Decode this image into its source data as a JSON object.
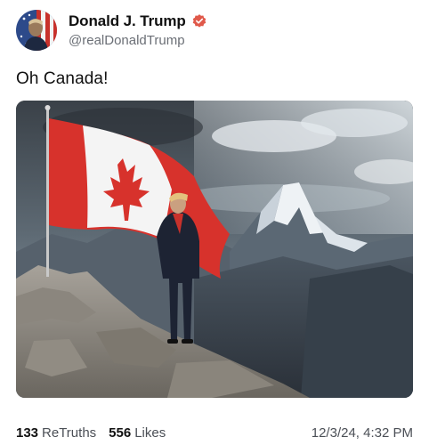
{
  "author": {
    "display_name": "Donald J. Trump",
    "handle": "@realDonaldTrump",
    "verified_badge_color": "#e0594a",
    "avatar_icon": "avatar-portrait"
  },
  "post": {
    "text": "Oh Canada!",
    "media_icon": "image-man-with-canadian-flag-on-mountain"
  },
  "stats": {
    "retruths_count": "133",
    "retruths_label": "ReTruths",
    "likes_count": "556",
    "likes_label": "Likes",
    "timestamp": "12/3/24, 4:32 PM"
  }
}
